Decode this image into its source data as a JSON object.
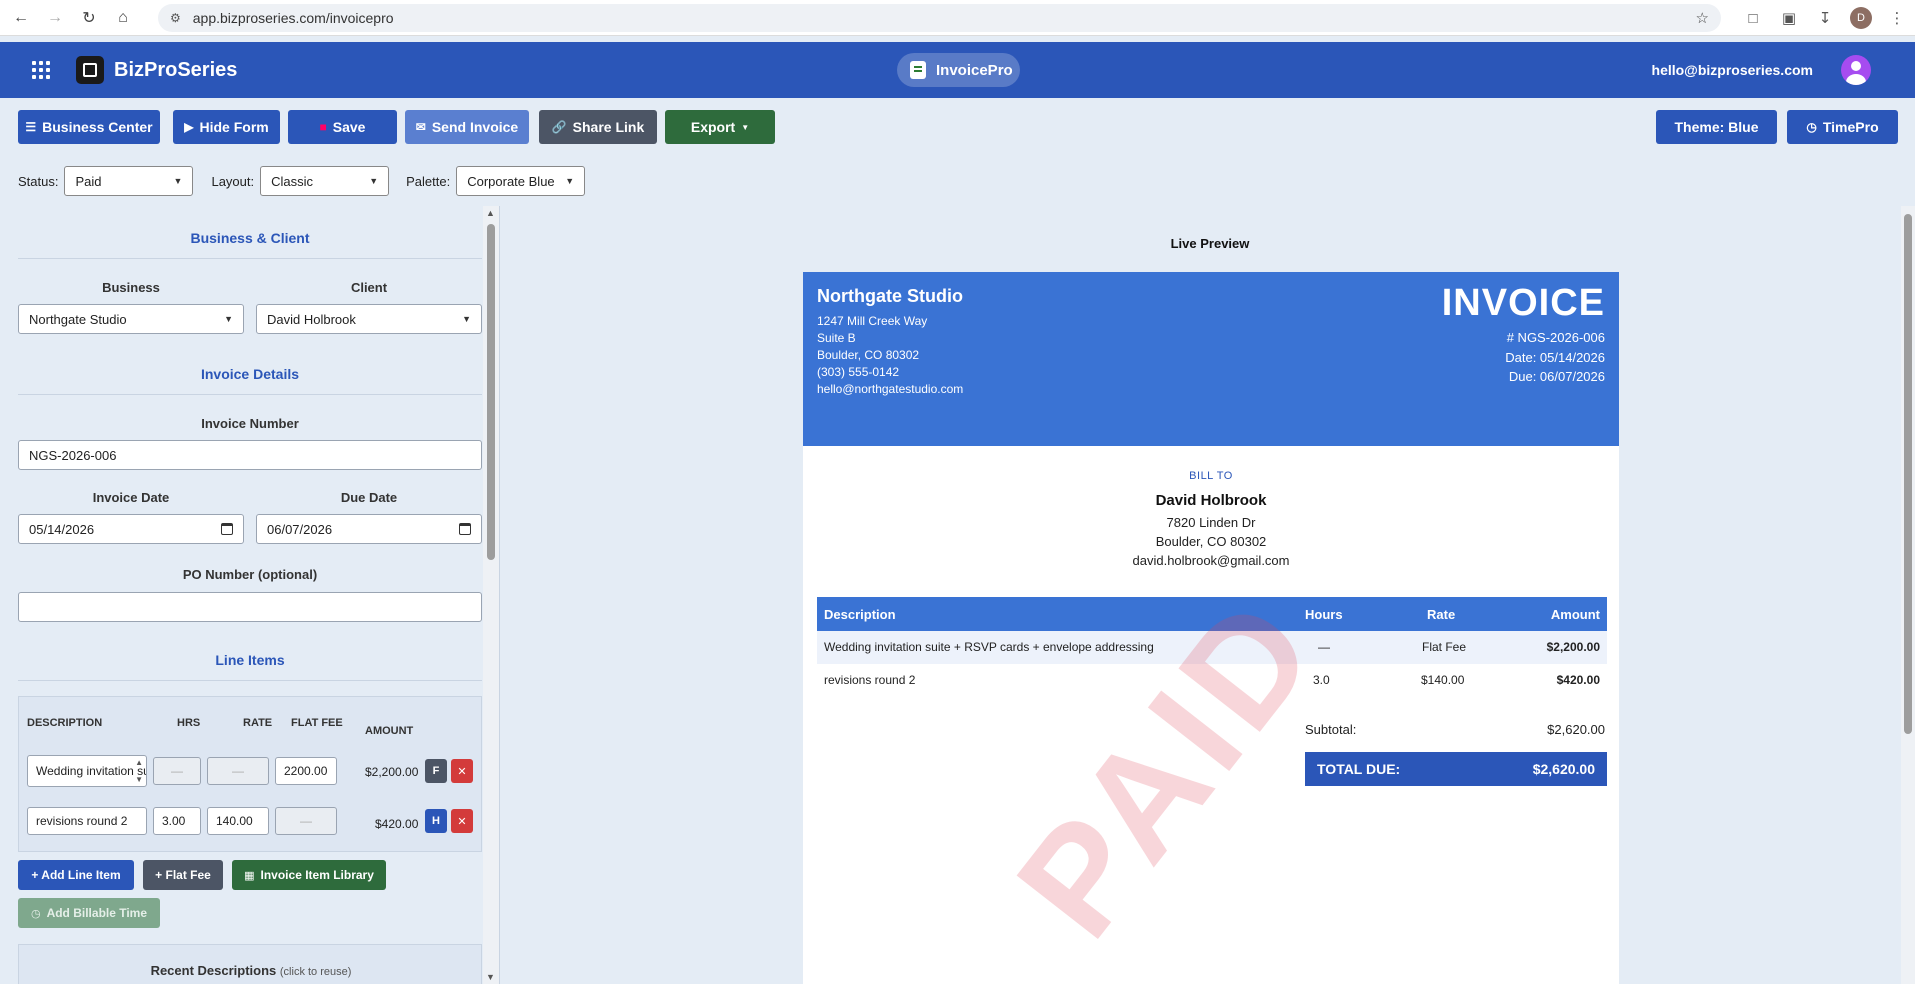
{
  "browser": {
    "url": "app.bizproseries.com/invoicepro",
    "profile_initial": "D"
  },
  "header": {
    "brand": "BizProSeries",
    "app_name": "InvoicePro",
    "user_email": "hello@bizproseries.com"
  },
  "toolbar": {
    "business_center": "Business Center",
    "hide_form": "Hide Form",
    "save": "Save",
    "send_invoice": "Send Invoice",
    "share_link": "Share Link",
    "export": "Export",
    "theme": "Theme: Blue",
    "timepro": "TimePro"
  },
  "filters": {
    "status_label": "Status:",
    "status_value": "Paid",
    "layout_label": "Layout:",
    "layout_value": "Classic",
    "palette_label": "Palette:",
    "palette_value": "Corporate Blue"
  },
  "form": {
    "section_business_client": "Business & Client",
    "business_label": "Business",
    "business_value": "Northgate Studio",
    "client_label": "Client",
    "client_value": "David Holbrook",
    "section_invoice_details": "Invoice Details",
    "invoice_number_label": "Invoice Number",
    "invoice_number_value": "NGS-2026-006",
    "invoice_date_label": "Invoice Date",
    "invoice_date_value": "05/14/2026",
    "due_date_label": "Due Date",
    "due_date_value": "06/07/2026",
    "po_label": "PO Number (optional)",
    "po_value": "",
    "section_line_items": "Line Items",
    "col_description": "DESCRIPTION",
    "col_hrs": "HRS",
    "col_rate": "RATE",
    "col_flat_fee": "FLAT FEE",
    "col_amount": "AMOUNT",
    "line_items": [
      {
        "description": "Wedding invitation suite",
        "hrs": "—",
        "rate": "—",
        "flat_fee": "2200.00",
        "amount": "$2,200.00",
        "type": "F"
      },
      {
        "description": "revisions round 2",
        "hrs": "3.00",
        "rate": "140.00",
        "flat_fee": "—",
        "amount": "$420.00",
        "type": "H"
      }
    ],
    "add_line_item": "+ Add Line Item",
    "flat_fee_btn": "+ Flat Fee",
    "item_library": "Invoice Item Library",
    "add_billable_time": "Add Billable Time",
    "recent_title": "Recent Descriptions",
    "recent_hint": "(click to reuse)"
  },
  "preview": {
    "title": "Live Preview",
    "business_name": "Northgate Studio",
    "business_address": [
      "1247 Mill Creek Way",
      "Suite B",
      "Boulder, CO 80302",
      "(303) 555-0142",
      "hello@northgatestudio.com"
    ],
    "invoice_word": "INVOICE",
    "invoice_number": "# NGS-2026-006",
    "date": "Date: 05/14/2026",
    "due": "Due: 06/07/2026",
    "bill_to_label": "BILL TO",
    "client_name": "David Holbrook",
    "client_address": [
      "7820 Linden Dr",
      "Boulder, CO 80302",
      "david.holbrook@gmail.com"
    ],
    "table_headers": {
      "description": "Description",
      "hours": "Hours",
      "rate": "Rate",
      "amount": "Amount"
    },
    "rows": [
      {
        "description": "Wedding invitation suite + RSVP cards + envelope addressing",
        "hours": "—",
        "rate": "Flat Fee",
        "amount": "$2,200.00"
      },
      {
        "description": "revisions round 2",
        "hours": "3.0",
        "rate": "$140.00",
        "amount": "$420.00"
      }
    ],
    "subtotal_label": "Subtotal:",
    "subtotal_value": "$2,620.00",
    "total_label": "TOTAL DUE:",
    "total_value": "$2,620.00",
    "stamp": "PAID"
  },
  "colors": {
    "header_blue": "#2b56b8",
    "invoice_blue": "#3a73d4",
    "green": "#2e6b3c",
    "stamp_red": "#e14655"
  }
}
